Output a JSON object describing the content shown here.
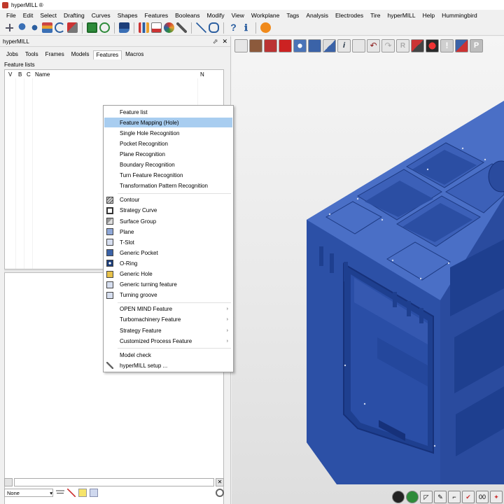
{
  "window": {
    "title": "hyperMILL ®"
  },
  "menubar": [
    "File",
    "Edit",
    "Select",
    "Drafting",
    "Curves",
    "Shapes",
    "Features",
    "Booleans",
    "Modify",
    "View",
    "Workplane",
    "Tags",
    "Analysis",
    "Electrodes",
    "Tire",
    "hyperMILL",
    "Help",
    "Hummingbird"
  ],
  "panel": {
    "title": "hyperMILL",
    "pin_symbol": "⬀",
    "close_symbol": "✕",
    "tabs": [
      "Jobs",
      "Tools",
      "Frames",
      "Models",
      "Features",
      "Macros"
    ],
    "active_tab": "Features",
    "feature_lists_label": "Feature lists",
    "columns": {
      "v": "V",
      "b": "B",
      "c": "C",
      "name": "Name",
      "n": "N"
    },
    "filter_select": "None"
  },
  "context_menu": {
    "items_top": [
      {
        "label": "Feature list"
      },
      {
        "label": "Feature Mapping (Hole)",
        "highlighted": true
      },
      {
        "label": "Single Hole Recognition"
      },
      {
        "label": "Pocket Recognition"
      },
      {
        "label": "Plane Recognition"
      },
      {
        "label": "Boundary Recognition"
      },
      {
        "label": "Turn Feature Recognition"
      },
      {
        "label": "Transformation Pattern Recognition"
      }
    ],
    "items_features": [
      {
        "label": "Contour",
        "icon": "contour-icon"
      },
      {
        "label": "Strategy Curve",
        "icon": "strategy-curve-icon"
      },
      {
        "label": "Surface Group",
        "icon": "surface-group-icon"
      },
      {
        "label": "Plane",
        "icon": "plane-icon"
      },
      {
        "label": "T-Slot",
        "icon": "t-slot-icon"
      },
      {
        "label": "Generic Pocket",
        "icon": "generic-pocket-icon"
      },
      {
        "label": "O-Ring",
        "icon": "o-ring-icon"
      },
      {
        "label": "Generic Hole",
        "icon": "generic-hole-icon"
      },
      {
        "label": "Generic turning feature",
        "icon": "turning-feature-icon"
      },
      {
        "label": "Turning groove",
        "icon": "turning-groove-icon"
      }
    ],
    "items_submenus": [
      {
        "label": "OPEN MIND Feature"
      },
      {
        "label": "Turbomachinery Feature"
      },
      {
        "label": "Strategy Feature"
      },
      {
        "label": "Customized Process Feature"
      }
    ],
    "items_bottom": [
      {
        "label": "Model check"
      },
      {
        "label": "hyperMILL setup ...",
        "icon": "wrench-icon"
      }
    ],
    "submenu_arrow": "›"
  },
  "viewport": {
    "bottom_text": "00"
  },
  "colors": {
    "model_blue": "#2f58b4",
    "highlight": "#a8cdf0",
    "menu_bg": "#ffffff"
  }
}
